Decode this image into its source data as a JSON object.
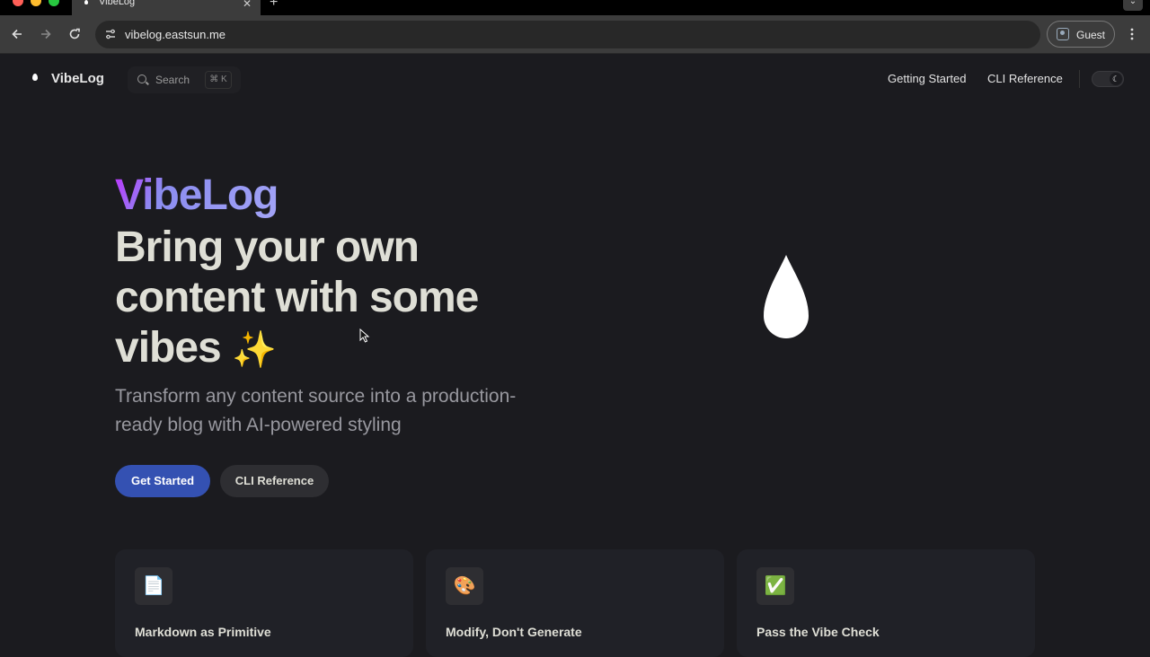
{
  "browser": {
    "tab_title": "VibeLog",
    "tab_close": "✕",
    "new_tab": "+",
    "tab_menu": "⌄",
    "url": "vibelog.eastsun.me",
    "profile_label": "Guest",
    "colors": {
      "close": "#ff5f57",
      "minimize": "#febc2e",
      "zoom": "#28c840"
    }
  },
  "header": {
    "logo_text": "VibeLog",
    "search_placeholder": "Search",
    "search_shortcut": "⌘ K",
    "nav": [
      "Getting Started",
      "CLI Reference"
    ],
    "theme_icon": "☾"
  },
  "hero": {
    "name": "VibeLog",
    "text_lines": [
      "Bring your own",
      "content with some",
      "vibes"
    ],
    "sparkle": "✨",
    "tagline": "Transform any content source into a production-ready blog with AI-powered styling",
    "actions": {
      "primary": "Get Started",
      "secondary": "CLI Reference"
    }
  },
  "features": [
    {
      "icon": "📄",
      "title": "Markdown as Primitive"
    },
    {
      "icon": "🎨",
      "title": "Modify, Don't Generate"
    },
    {
      "icon": "✅",
      "title": "Pass the Vibe Check"
    }
  ],
  "colors": {
    "accent": "#3451b2",
    "brand_gradient_start": "#bd34fe",
    "brand_gradient_end": "#a3a4f7",
    "background": "#1b1b1f"
  }
}
